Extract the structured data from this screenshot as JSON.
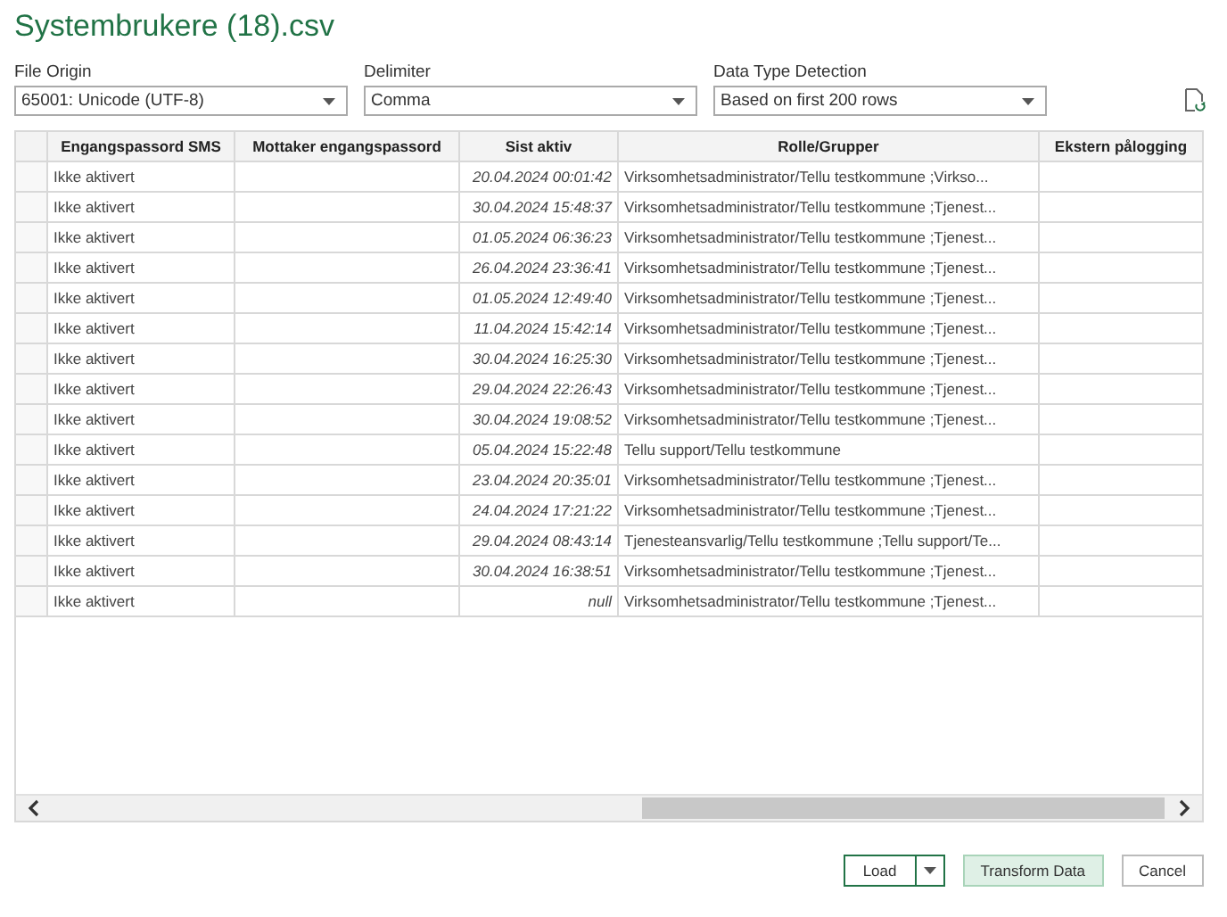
{
  "window": {
    "title": "Systembrukere (18).csv"
  },
  "options": [
    {
      "label": "File Origin",
      "value": "65001: Unicode (UTF-8)"
    },
    {
      "label": "Delimiter",
      "value": "Comma"
    },
    {
      "label": "Data Type Detection",
      "value": "Based on first 200 rows"
    }
  ],
  "table": {
    "columns": [
      "Engangspassord SMS",
      "Mottaker engangspassord",
      "Sist aktiv",
      "Rolle/Grupper",
      "Ekstern pålogging"
    ],
    "rows": [
      [
        "Ikke aktivert",
        "",
        "20.04.2024 00:01:42",
        "Virksomhetsadministrator/Tellu testkommune ;Virkso...",
        ""
      ],
      [
        "Ikke aktivert",
        "",
        "30.04.2024 15:48:37",
        "Virksomhetsadministrator/Tellu testkommune ;Tjenest...",
        ""
      ],
      [
        "Ikke aktivert",
        "",
        "01.05.2024 06:36:23",
        "Virksomhetsadministrator/Tellu testkommune ;Tjenest...",
        ""
      ],
      [
        "Ikke aktivert",
        "",
        "26.04.2024 23:36:41",
        "Virksomhetsadministrator/Tellu testkommune ;Tjenest...",
        ""
      ],
      [
        "Ikke aktivert",
        "",
        "01.05.2024 12:49:40",
        "Virksomhetsadministrator/Tellu testkommune ;Tjenest...",
        ""
      ],
      [
        "Ikke aktivert",
        "",
        "11.04.2024 15:42:14",
        "Virksomhetsadministrator/Tellu testkommune ;Tjenest...",
        ""
      ],
      [
        "Ikke aktivert",
        "",
        "30.04.2024 16:25:30",
        "Virksomhetsadministrator/Tellu testkommune ;Tjenest...",
        ""
      ],
      [
        "Ikke aktivert",
        "",
        "29.04.2024 22:26:43",
        "Virksomhetsadministrator/Tellu testkommune ;Tjenest...",
        ""
      ],
      [
        "Ikke aktivert",
        "",
        "30.04.2024 19:08:52",
        "Virksomhetsadministrator/Tellu testkommune ;Tjenest...",
        ""
      ],
      [
        "Ikke aktivert",
        "",
        "05.04.2024 15:22:48",
        "Tellu support/Tellu testkommune",
        ""
      ],
      [
        "Ikke aktivert",
        "",
        "23.04.2024 20:35:01",
        "Virksomhetsadministrator/Tellu testkommune ;Tjenest...",
        ""
      ],
      [
        "Ikke aktivert",
        "",
        "24.04.2024 17:21:22",
        "Virksomhetsadministrator/Tellu testkommune ;Tjenest...",
        ""
      ],
      [
        "Ikke aktivert",
        "",
        "29.04.2024 08:43:14",
        "Tjenesteansvarlig/Tellu testkommune ;Tellu support/Te...",
        ""
      ],
      [
        "Ikke aktivert",
        "",
        "30.04.2024 16:38:51",
        "Virksomhetsadministrator/Tellu testkommune ;Tjenest...",
        ""
      ],
      [
        "Ikke aktivert",
        "",
        "null",
        "Virksomhetsadministrator/Tellu testkommune ;Tjenest...",
        ""
      ]
    ]
  },
  "buttons": [
    {
      "label": "Load",
      "kind": "split"
    },
    {
      "label": "Transform Data",
      "kind": "primary"
    },
    {
      "label": "Cancel",
      "kind": "plain"
    }
  ]
}
